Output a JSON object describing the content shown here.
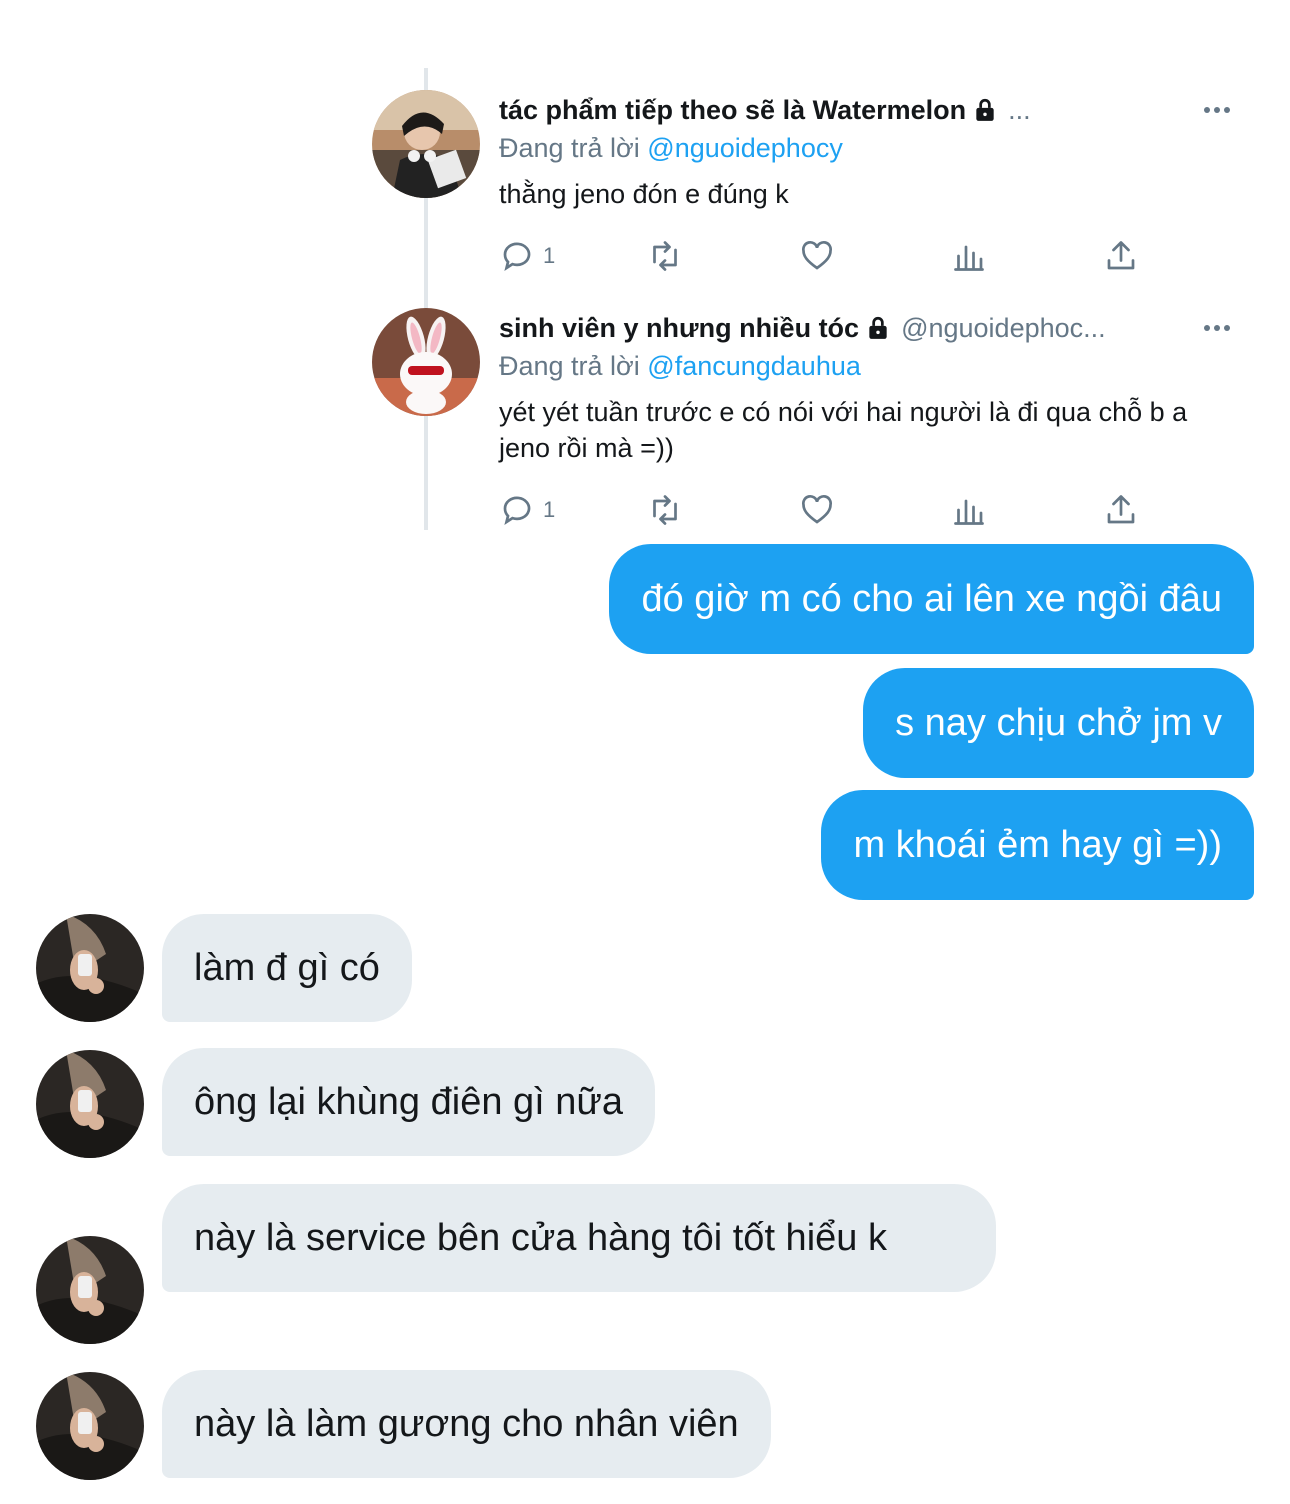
{
  "tweets": [
    {
      "name": "tác phẩm tiếp theo sẽ là Watermelon",
      "handle": "...",
      "reply_prefix": "Đang trả lời",
      "reply_to": "@nguoidephocy",
      "text": "thằng jeno đón e đúng k",
      "reply_count": "1"
    },
    {
      "name": "sinh viên y nhưng nhiều tóc",
      "handle": "@nguoidephoc...",
      "reply_prefix": "Đang trả lời",
      "reply_to": "@fancungdauhua",
      "text": "yét yét tuần trước e có nói với hai người là đi qua chỗ b a jeno rồi mà =))",
      "reply_count": "1"
    }
  ],
  "messages": {
    "outgoing": [
      "đó giờ m có cho ai lên xe ngồi đâu",
      "s nay chịu chở jm v",
      "m khoái ẻm hay gì =))"
    ],
    "incoming": [
      "làm đ gì có",
      "ông lại khùng điên gì nữa",
      "này là service bên cửa hàng tôi tốt hiểu k",
      "này là làm gương cho nhân viên"
    ]
  },
  "icons": [
    "lock-icon",
    "more-icon",
    "reply-icon",
    "retweet-icon",
    "like-icon",
    "analytics-icon",
    "share-icon"
  ],
  "colors": {
    "accent": "#1da1f2",
    "incoming_bubble": "#e6ecf0",
    "secondary_text": "#657786"
  }
}
